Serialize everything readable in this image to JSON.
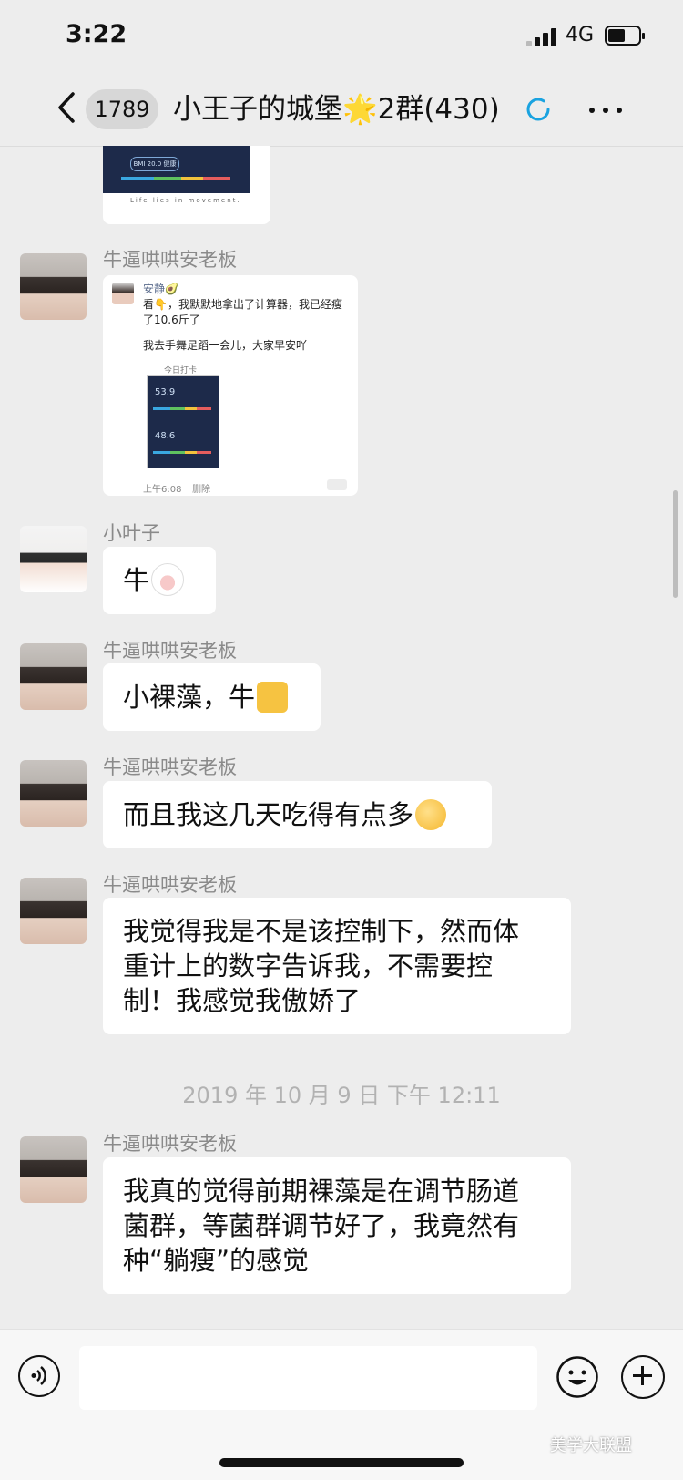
{
  "status_bar": {
    "time": "3:22",
    "network": "4G"
  },
  "header": {
    "unread_count": "1789",
    "title": "小王子的城堡🌟2群(430)"
  },
  "top_image": {
    "bmi_label": "BMI 20.0 健康",
    "caption": "Life lies in movement."
  },
  "messages": [
    {
      "sender": "牛逼哄哄安老板",
      "type": "image",
      "quoted": {
        "name": "安静🥑",
        "text1": "看👇，我默默地拿出了计算器，我已经瘦了10.6斤了",
        "text2": "我去手舞足蹈一会儿，大家早安吖",
        "card_label": "今日打卡",
        "value1": "53.9",
        "value2": "48.6",
        "time": "上午6:08",
        "delete": "删除"
      }
    },
    {
      "sender": "小叶子",
      "text": "牛"
    },
    {
      "sender": "牛逼哄哄安老板",
      "text": "小裸藻，牛"
    },
    {
      "sender": "牛逼哄哄安老板",
      "text": "而且我这几天吃得有点多"
    },
    {
      "sender": "牛逼哄哄安老板",
      "lines": [
        "我觉得我是不是该控制下，然而体",
        "重计上的数字告诉我，不需要控",
        "制！我感觉我傲娇了"
      ]
    },
    {
      "sender": "牛逼哄哄安老板",
      "lines": [
        "我真的觉得前期裸藻是在调节肠道",
        "菌群，等菌群调节好了，我竟然有",
        "种“躺瘦”的感觉"
      ]
    }
  ],
  "timestamp": "2019 年 10 月 9 日  下午 12:11",
  "watermark": "美学大联盟",
  "colors": {
    "background": "#ededed",
    "bubble": "#ffffff",
    "name": "#8a8a8a",
    "loading": "#1aa3e0"
  }
}
